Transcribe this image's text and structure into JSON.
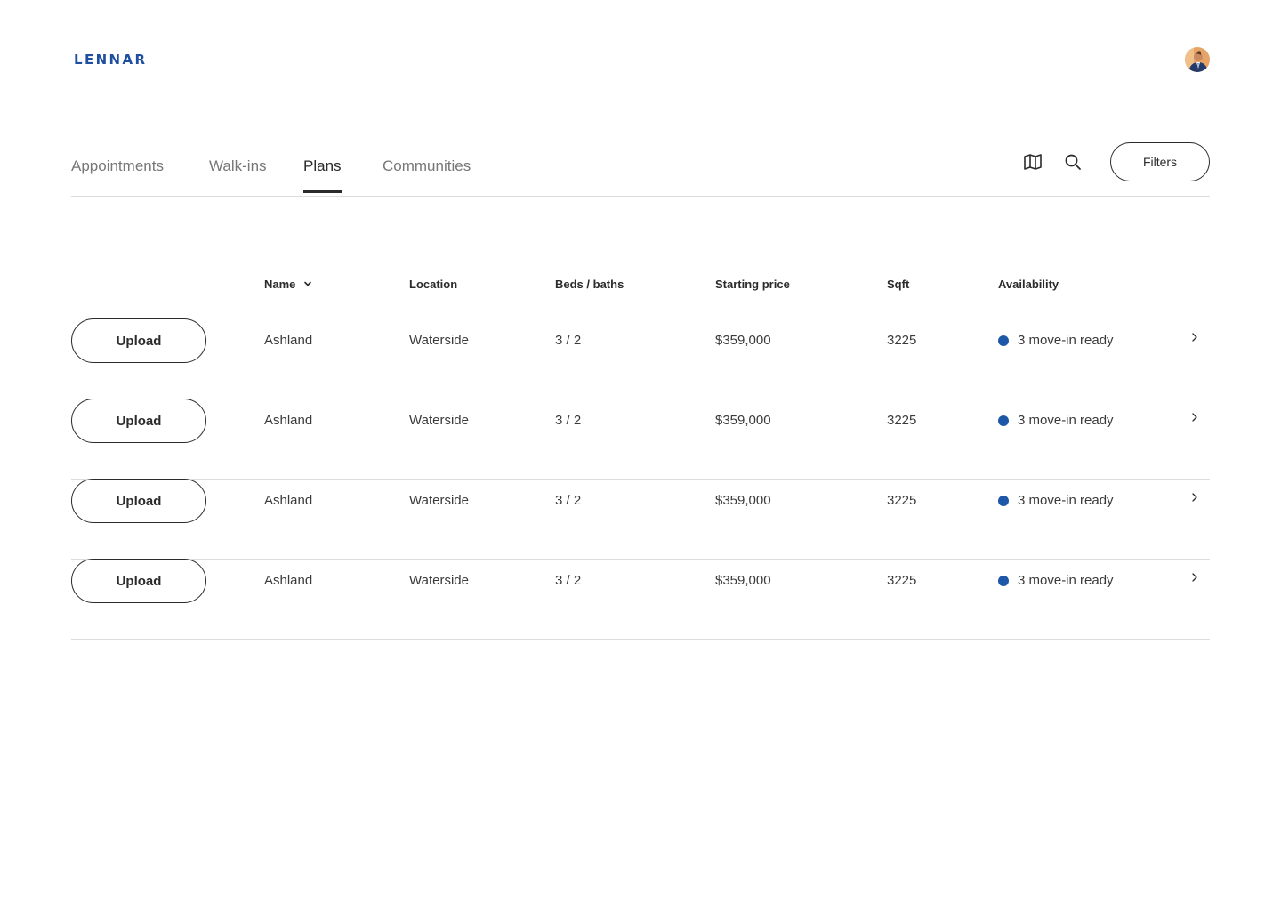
{
  "brand": {
    "logo_text": "LENNAR",
    "color": "#1f4fa0"
  },
  "user": {
    "avatar_icon": "user-avatar"
  },
  "tabs": [
    {
      "label": "Appointments",
      "active": false
    },
    {
      "label": "Walk-ins",
      "active": false
    },
    {
      "label": "Plans",
      "active": true
    },
    {
      "label": "Communities",
      "active": false
    }
  ],
  "toolbar": {
    "map_icon": "map-icon",
    "search_icon": "search-icon",
    "filters_label": "Filters"
  },
  "table": {
    "sort_icon": "chevron-down-icon",
    "columns": [
      "Name",
      "Location",
      "Beds / baths",
      "Starting price",
      "Sqft",
      "Availability"
    ],
    "upload_label": "Upload",
    "status_color": "#1f57a8",
    "rows": [
      {
        "name": "Ashland",
        "location": "Waterside",
        "beds_baths": "3 / 2",
        "price": "$359,000",
        "sqft": "3225",
        "availability": "3 move-in ready"
      },
      {
        "name": "Ashland",
        "location": "Waterside",
        "beds_baths": "3 / 2",
        "price": "$359,000",
        "sqft": "3225",
        "availability": "3 move-in ready"
      },
      {
        "name": "Ashland",
        "location": "Waterside",
        "beds_baths": "3 / 2",
        "price": "$359,000",
        "sqft": "3225",
        "availability": "3 move-in ready"
      },
      {
        "name": "Ashland",
        "location": "Waterside",
        "beds_baths": "3 / 2",
        "price": "$359,000",
        "sqft": "3225",
        "availability": "3 move-in ready"
      }
    ]
  }
}
